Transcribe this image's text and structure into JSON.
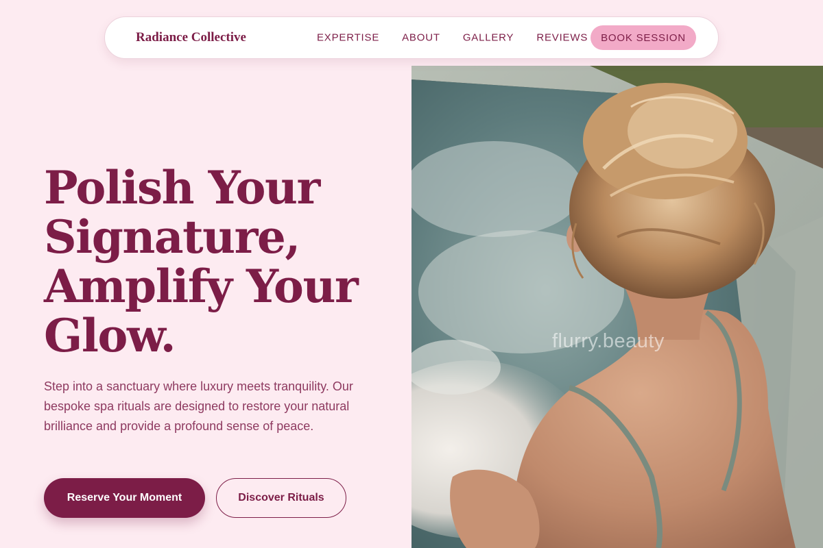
{
  "nav": {
    "brand": "Radiance Collective",
    "links": [
      "EXPERTISE",
      "ABOUT",
      "GALLERY",
      "REVIEWS"
    ],
    "cta": "BOOK SESSION"
  },
  "hero": {
    "title_lines": [
      "Polish Your",
      "Signature,",
      "Amplify Your",
      "Glow."
    ],
    "subtitle": "Step into a sanctuary where luxury meets tranquility. Our bespoke spa rituals are designed to restore your natural brilliance and provide a profound sense of peace.",
    "primary_button": "Reserve Your Moment",
    "secondary_button": "Discover Rituals",
    "image_watermark": "flurry.beauty"
  },
  "colors": {
    "background": "#fdebf1",
    "primary": "#7c1d47",
    "accent_pink": "#f2aac7"
  }
}
